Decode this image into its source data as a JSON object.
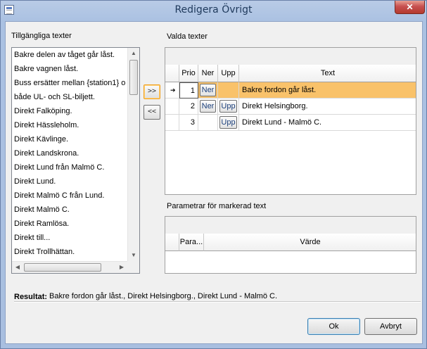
{
  "window": {
    "title": "Redigera Övrigt",
    "close_glyph": "✕"
  },
  "available": {
    "label": "Tillgängliga texter",
    "items": [
      "Bakre delen av tåget går låst.",
      "Bakre vagnen låst.",
      "Buss ersätter mellan {station1} o",
      "både UL- och SL-biljett.",
      "Direkt Falköping.",
      "Direkt Hässleholm.",
      "Direkt Kävlinge.",
      "Direkt Landskrona.",
      "Direkt Lund från Malmö C.",
      "Direkt Lund.",
      "Direkt Malmö C från Lund.",
      "Direkt Malmö C.",
      "Direkt Ramlösa.",
      "Direkt till...",
      "Direkt Trollhättan."
    ]
  },
  "transfer": {
    "add_label": ">>",
    "remove_label": "<<"
  },
  "selected": {
    "label": "Valda texter",
    "columns": {
      "prio": "Prio",
      "down": "Ner",
      "up": "Upp",
      "text": "Text"
    },
    "rows": [
      {
        "prio": "1",
        "down": "Ner",
        "up": "",
        "text": "Bakre fordon går låst.",
        "indicator": "➔"
      },
      {
        "prio": "2",
        "down": "Ner",
        "up": "Upp",
        "text": "Direkt Helsingborg.",
        "indicator": ""
      },
      {
        "prio": "3",
        "down": "",
        "up": "Upp",
        "text": "Direkt Lund - Malmö C.",
        "indicator": ""
      }
    ]
  },
  "params": {
    "label": "Parametrar för markerad text",
    "columns": {
      "param": "Para...",
      "value": "Värde"
    }
  },
  "result": {
    "label": "Resultat:",
    "value": "Bakre fordon går låst., Direkt Helsingborg., Direkt Lund - Malmö C."
  },
  "buttons": {
    "ok": "Ok",
    "cancel": "Avbryt"
  },
  "icons": {
    "scroll_up": "▲",
    "scroll_down": "▼",
    "scroll_left": "◀",
    "scroll_right": "▶"
  },
  "colors": {
    "selected_row": "#f9c26a",
    "close_button": "#c75050"
  }
}
